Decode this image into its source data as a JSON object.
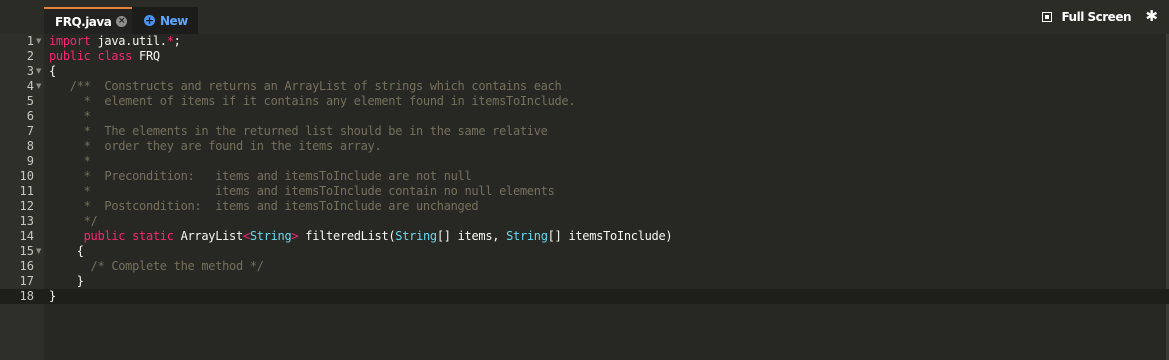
{
  "tabs": {
    "file_label": "FRQ.java",
    "new_label": "New"
  },
  "toolbar": {
    "fullscreen_label": "Full Screen"
  },
  "code_lines": [
    {
      "n": "1",
      "fold": true
    },
    {
      "n": "2",
      "fold": false
    },
    {
      "n": "3",
      "fold": true
    },
    {
      "n": "4",
      "fold": true
    },
    {
      "n": "5",
      "fold": false
    },
    {
      "n": "6",
      "fold": false
    },
    {
      "n": "7",
      "fold": false
    },
    {
      "n": "8",
      "fold": false
    },
    {
      "n": "9",
      "fold": false
    },
    {
      "n": "10",
      "fold": false
    },
    {
      "n": "11",
      "fold": false
    },
    {
      "n": "12",
      "fold": false
    },
    {
      "n": "13",
      "fold": false
    },
    {
      "n": "14",
      "fold": false
    },
    {
      "n": "15",
      "fold": true
    },
    {
      "n": "16",
      "fold": false
    },
    {
      "n": "17",
      "fold": false
    },
    {
      "n": "18",
      "fold": false
    }
  ],
  "code": {
    "l1_kw": "import",
    "l1_rest": " java.util.",
    "l1_star": "*",
    "l1_end": ";",
    "l2_kw": "public class",
    "l2_name": " FRQ",
    "l3": "{",
    "l4": "   /**  Constructs and returns an ArrayList of strings which contains each",
    "l5": "     *  element of items if it contains any element found in itemsToInclude.",
    "l6": "     *",
    "l7": "     *  The elements in the returned list should be in the same relative",
    "l8": "     *  order they are found in the items array.",
    "l9": "     *",
    "l10": "     *  Precondition:   items and itemsToInclude are not null",
    "l11": "     *                  items and itemsToInclude contain no null elements",
    "l12": "     *  Postcondition:  items and itemsToInclude are unchanged",
    "l13": "     */",
    "l14_indent": "     ",
    "l14_kw": "public static",
    "l14_a": " ArrayList",
    "l14_lt": "<",
    "l14_type1": "String",
    "l14_gt": ">",
    "l14_b": " filteredList(",
    "l14_type2": "String",
    "l14_c": "[] items, ",
    "l14_type3": "String",
    "l14_d": "[] itemsToInclude)",
    "l15": "    {",
    "l16": "      /* Complete the method */",
    "l17": "    }",
    "l18": "}"
  }
}
